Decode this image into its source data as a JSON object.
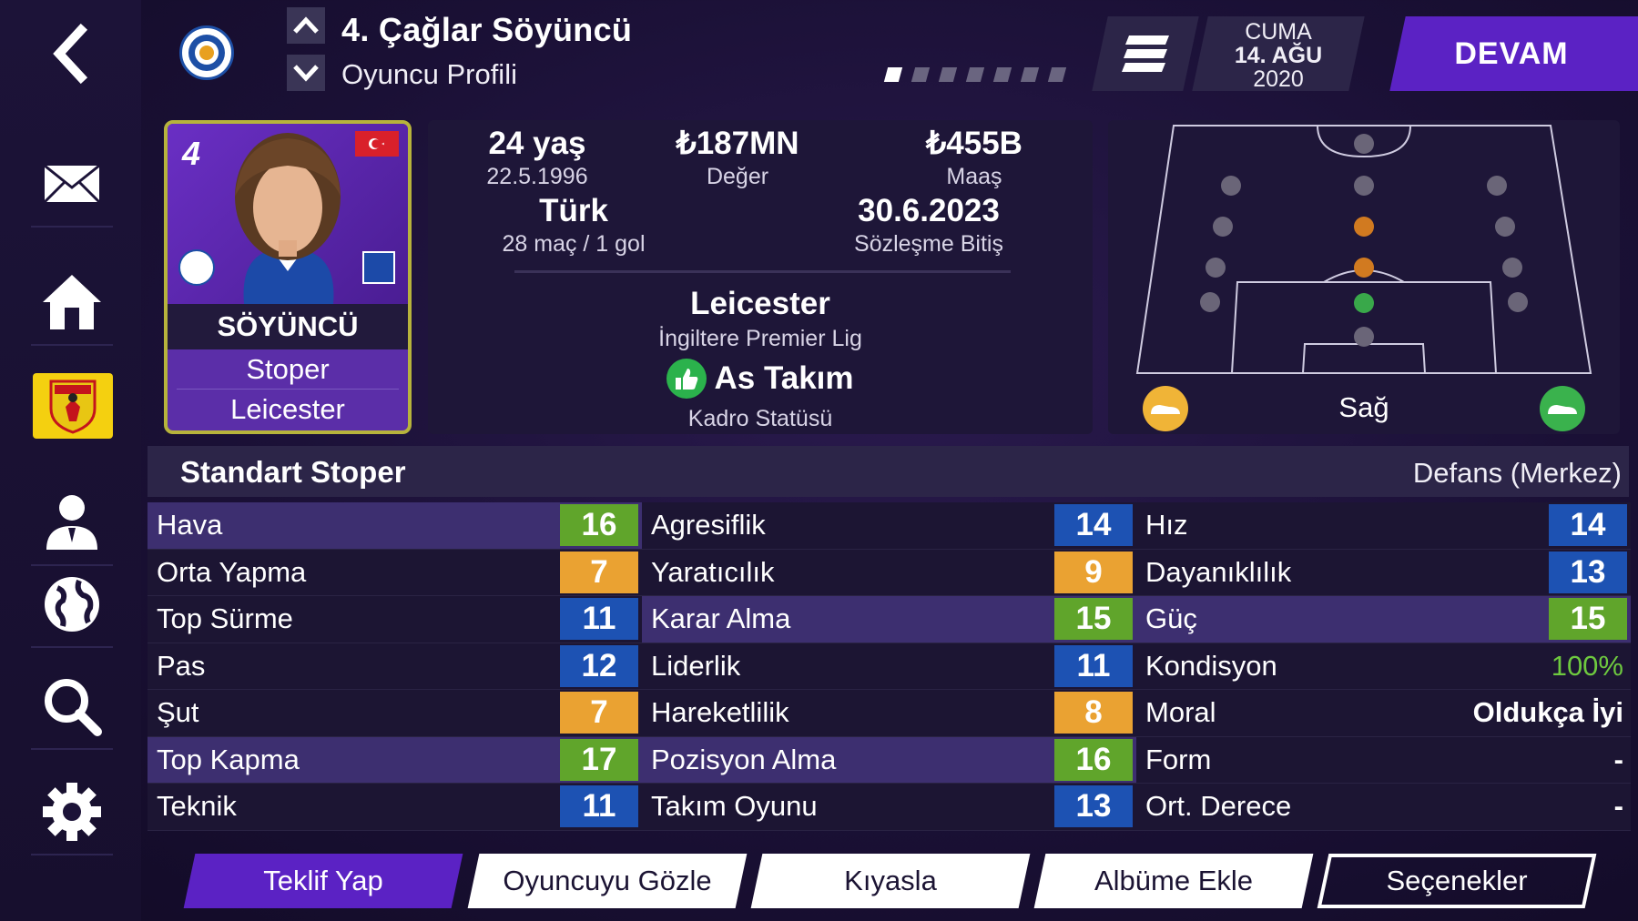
{
  "header": {
    "title": "4. Çağlar Söyüncü",
    "subtitle": "Oyuncu Profili",
    "date_day": "CUMA",
    "date_month": "14. AĞU",
    "date_year": "2020",
    "continue_label": "DEVAM",
    "page_count": 7,
    "active_page": 1
  },
  "sidebar": {
    "items": [
      "back-icon",
      "mail-icon",
      "home-icon",
      "club-badge",
      "person-icon",
      "globe-icon",
      "search-icon",
      "gear-icon"
    ]
  },
  "card": {
    "shirt_number": "4",
    "surname": "SÖYÜNCÜ",
    "position": "Stoper",
    "club": "Leicester"
  },
  "info": {
    "age": "24 yaş",
    "birth_date": "22.5.1996",
    "value": "₺187MN",
    "value_label": "Değer",
    "wage": "₺455B",
    "wage_label": "Maaş",
    "nationality": "Türk",
    "apps": "28 maç / 1 gol",
    "contract_end": "30.6.2023",
    "contract_label": "Sözleşme Bitiş",
    "club": "Leicester",
    "league": "İngiltere Premier Lig",
    "squad_status": "As Takım",
    "squad_status_label": "Kadro Statüsü"
  },
  "pitch": {
    "foot_label": "Sağ"
  },
  "attributes": {
    "title": "Standart Stoper",
    "role": "Defans (Merkez)",
    "columns": [
      [
        {
          "label": "Hava",
          "value": "16",
          "color": "green",
          "hl": true
        },
        {
          "label": "Orta Yapma",
          "value": "7",
          "color": "orange",
          "hl": false
        },
        {
          "label": "Top Sürme",
          "value": "11",
          "color": "blue",
          "hl": false
        },
        {
          "label": "Pas",
          "value": "12",
          "color": "blue",
          "hl": false
        },
        {
          "label": "Şut",
          "value": "7",
          "color": "orange",
          "hl": false
        },
        {
          "label": "Top Kapma",
          "value": "17",
          "color": "green",
          "hl": true
        },
        {
          "label": "Teknik",
          "value": "11",
          "color": "blue",
          "hl": false
        }
      ],
      [
        {
          "label": "Agresiflik",
          "value": "14",
          "color": "blue",
          "hl": false
        },
        {
          "label": "Yaratıcılık",
          "value": "9",
          "color": "orange",
          "hl": false
        },
        {
          "label": "Karar Alma",
          "value": "15",
          "color": "green",
          "hl": true
        },
        {
          "label": "Liderlik",
          "value": "11",
          "color": "blue",
          "hl": false
        },
        {
          "label": "Hareketlilik",
          "value": "8",
          "color": "orange",
          "hl": false
        },
        {
          "label": "Pozisyon Alma",
          "value": "16",
          "color": "green",
          "hl": true
        },
        {
          "label": "Takım Oyunu",
          "value": "13",
          "color": "blue",
          "hl": false
        }
      ],
      [
        {
          "label": "Hız",
          "value": "14",
          "color": "blue",
          "hl": false
        },
        {
          "label": "Dayanıklılık",
          "value": "13",
          "color": "blue",
          "hl": false
        },
        {
          "label": "Güç",
          "value": "15",
          "color": "green",
          "hl": true
        },
        {
          "label": "Kondisyon",
          "text": "100%",
          "text_style": "green",
          "hl": false
        },
        {
          "label": "Moral",
          "text": "Oldukça İyi",
          "text_style": "bold",
          "hl": false
        },
        {
          "label": "Form",
          "text": "-",
          "text_style": "bold",
          "hl": false
        },
        {
          "label": "Ort. Derece",
          "text": "-",
          "text_style": "bold",
          "hl": false
        }
      ]
    ]
  },
  "buttons": {
    "offer": "Teklif Yap",
    "scout": "Oyuncuyu Gözle",
    "compare": "Kıyasla",
    "album": "Albüme Ekle",
    "options": "Seçenekler"
  },
  "colors": {
    "accent_purple": "#5b22c4",
    "attr_blue": "#1d52b3",
    "attr_orange": "#eaa232",
    "attr_green": "#60a52b"
  }
}
